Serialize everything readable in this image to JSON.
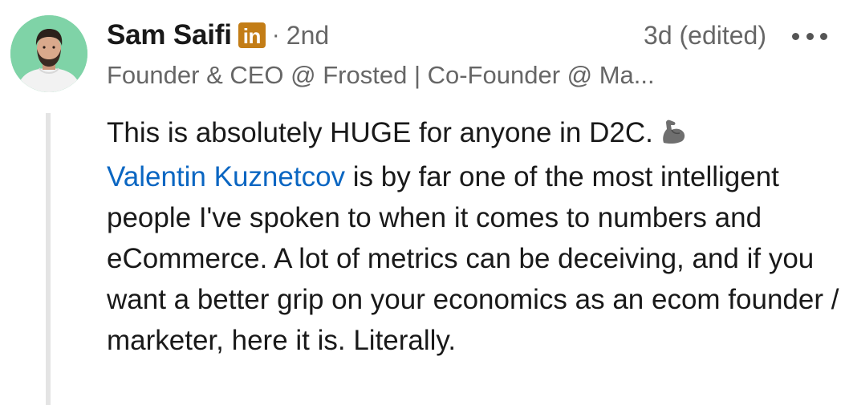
{
  "author": {
    "name": "Sam Saifi",
    "badge": "in",
    "separator": "·",
    "degree": "2nd",
    "headline": "Founder & CEO @ Frosted | Co-Founder @ Ma..."
  },
  "meta": {
    "timestamp": "3d (edited)"
  },
  "comment": {
    "text_before_mention": "This is absolutely HUGE for anyone in D2C.",
    "emoji": "flexed-biceps",
    "mention": "Valentin Kuznetcov",
    "text_after_mention": " is by far one of the most intelligent people I've spoken to when it comes to numbers and eCommerce. A lot of metrics can be deceiving, and if you want a better grip on your economics as an ecom founder / marketer, here it is. Literally."
  },
  "icons": {
    "avatar": "profile-avatar",
    "badge": "linkedin-premium-badge",
    "more": "more-options-icon",
    "emoji": "flexed-biceps-emoji"
  },
  "colors": {
    "avatar_bg": "#7fd3a7",
    "badge_bg": "#c37d16",
    "mention": "#0a66c2",
    "secondary_text": "#666666"
  }
}
